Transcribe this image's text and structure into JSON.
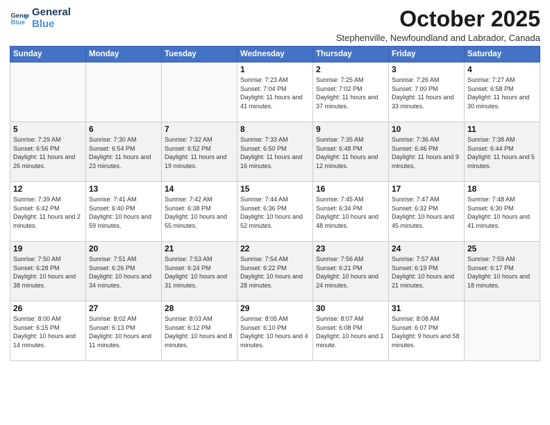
{
  "logo": {
    "line1": "General",
    "line2": "Blue"
  },
  "title": "October 2025",
  "subtitle": "Stephenville, Newfoundland and Labrador, Canada",
  "days_header": [
    "Sunday",
    "Monday",
    "Tuesday",
    "Wednesday",
    "Thursday",
    "Friday",
    "Saturday"
  ],
  "weeks": [
    [
      {
        "day": "",
        "info": ""
      },
      {
        "day": "",
        "info": ""
      },
      {
        "day": "",
        "info": ""
      },
      {
        "day": "1",
        "info": "Sunrise: 7:23 AM\nSunset: 7:04 PM\nDaylight: 11 hours\nand 41 minutes."
      },
      {
        "day": "2",
        "info": "Sunrise: 7:25 AM\nSunset: 7:02 PM\nDaylight: 11 hours\nand 37 minutes."
      },
      {
        "day": "3",
        "info": "Sunrise: 7:26 AM\nSunset: 7:00 PM\nDaylight: 11 hours\nand 33 minutes."
      },
      {
        "day": "4",
        "info": "Sunrise: 7:27 AM\nSunset: 6:58 PM\nDaylight: 11 hours\nand 30 minutes."
      }
    ],
    [
      {
        "day": "5",
        "info": "Sunrise: 7:29 AM\nSunset: 6:56 PM\nDaylight: 11 hours\nand 26 minutes."
      },
      {
        "day": "6",
        "info": "Sunrise: 7:30 AM\nSunset: 6:54 PM\nDaylight: 11 hours\nand 23 minutes."
      },
      {
        "day": "7",
        "info": "Sunrise: 7:32 AM\nSunset: 6:52 PM\nDaylight: 11 hours\nand 19 minutes."
      },
      {
        "day": "8",
        "info": "Sunrise: 7:33 AM\nSunset: 6:50 PM\nDaylight: 11 hours\nand 16 minutes."
      },
      {
        "day": "9",
        "info": "Sunrise: 7:35 AM\nSunset: 6:48 PM\nDaylight: 11 hours\nand 12 minutes."
      },
      {
        "day": "10",
        "info": "Sunrise: 7:36 AM\nSunset: 6:46 PM\nDaylight: 11 hours\nand 9 minutes."
      },
      {
        "day": "11",
        "info": "Sunrise: 7:38 AM\nSunset: 6:44 PM\nDaylight: 11 hours\nand 5 minutes."
      }
    ],
    [
      {
        "day": "12",
        "info": "Sunrise: 7:39 AM\nSunset: 6:42 PM\nDaylight: 11 hours\nand 2 minutes."
      },
      {
        "day": "13",
        "info": "Sunrise: 7:41 AM\nSunset: 6:40 PM\nDaylight: 10 hours\nand 59 minutes."
      },
      {
        "day": "14",
        "info": "Sunrise: 7:42 AM\nSunset: 6:38 PM\nDaylight: 10 hours\nand 55 minutes."
      },
      {
        "day": "15",
        "info": "Sunrise: 7:44 AM\nSunset: 6:36 PM\nDaylight: 10 hours\nand 52 minutes."
      },
      {
        "day": "16",
        "info": "Sunrise: 7:45 AM\nSunset: 6:34 PM\nDaylight: 10 hours\nand 48 minutes."
      },
      {
        "day": "17",
        "info": "Sunrise: 7:47 AM\nSunset: 6:32 PM\nDaylight: 10 hours\nand 45 minutes."
      },
      {
        "day": "18",
        "info": "Sunrise: 7:48 AM\nSunset: 6:30 PM\nDaylight: 10 hours\nand 41 minutes."
      }
    ],
    [
      {
        "day": "19",
        "info": "Sunrise: 7:50 AM\nSunset: 6:28 PM\nDaylight: 10 hours\nand 38 minutes."
      },
      {
        "day": "20",
        "info": "Sunrise: 7:51 AM\nSunset: 6:26 PM\nDaylight: 10 hours\nand 34 minutes."
      },
      {
        "day": "21",
        "info": "Sunrise: 7:53 AM\nSunset: 6:24 PM\nDaylight: 10 hours\nand 31 minutes."
      },
      {
        "day": "22",
        "info": "Sunrise: 7:54 AM\nSunset: 6:22 PM\nDaylight: 10 hours\nand 28 minutes."
      },
      {
        "day": "23",
        "info": "Sunrise: 7:56 AM\nSunset: 6:21 PM\nDaylight: 10 hours\nand 24 minutes."
      },
      {
        "day": "24",
        "info": "Sunrise: 7:57 AM\nSunset: 6:19 PM\nDaylight: 10 hours\nand 21 minutes."
      },
      {
        "day": "25",
        "info": "Sunrise: 7:59 AM\nSunset: 6:17 PM\nDaylight: 10 hours\nand 18 minutes."
      }
    ],
    [
      {
        "day": "26",
        "info": "Sunrise: 8:00 AM\nSunset: 6:15 PM\nDaylight: 10 hours\nand 14 minutes."
      },
      {
        "day": "27",
        "info": "Sunrise: 8:02 AM\nSunset: 6:13 PM\nDaylight: 10 hours\nand 11 minutes."
      },
      {
        "day": "28",
        "info": "Sunrise: 8:03 AM\nSunset: 6:12 PM\nDaylight: 10 hours\nand 8 minutes."
      },
      {
        "day": "29",
        "info": "Sunrise: 8:05 AM\nSunset: 6:10 PM\nDaylight: 10 hours\nand 4 minutes."
      },
      {
        "day": "30",
        "info": "Sunrise: 8:07 AM\nSunset: 6:08 PM\nDaylight: 10 hours\nand 1 minute."
      },
      {
        "day": "31",
        "info": "Sunrise: 8:08 AM\nSunset: 6:07 PM\nDaylight: 9 hours\nand 58 minutes."
      },
      {
        "day": "",
        "info": ""
      }
    ]
  ]
}
